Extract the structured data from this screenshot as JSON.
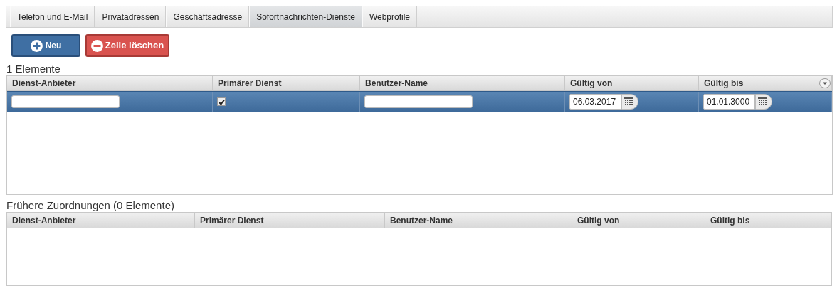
{
  "tabs": [
    {
      "label": "Telefon und E-Mail",
      "selected": false
    },
    {
      "label": "Privatadressen",
      "selected": false
    },
    {
      "label": "Geschäftsadresse",
      "selected": false
    },
    {
      "label": "Sofortnachrichten-Dienste",
      "selected": true
    },
    {
      "label": "Webprofile",
      "selected": false
    }
  ],
  "toolbar": {
    "new_button": "Neu",
    "delete_button": "Zeile löschen"
  },
  "current": {
    "count_label": "1 Elemente",
    "columns": [
      "Dienst-Anbieter",
      "Primärer Dienst",
      "Benutzer-Name",
      "Gültig von",
      "Gültig bis"
    ],
    "rows": [
      {
        "selected": true,
        "cells": [
          {
            "kind": "text"
          },
          {
            "kind": "checkbox",
            "checked": true
          },
          {
            "kind": "text"
          },
          {
            "kind": "date",
            "value": "06.03.2017"
          },
          {
            "kind": "date",
            "value": "01.01.3000"
          }
        ]
      }
    ]
  },
  "history": {
    "title": "Frühere Zuordnungen (0 Elemente)",
    "columns": [
      "Dienst-Anbieter",
      "Primärer Dienst",
      "Benutzer-Name",
      "Gültig von",
      "Gültig bis"
    ]
  }
}
